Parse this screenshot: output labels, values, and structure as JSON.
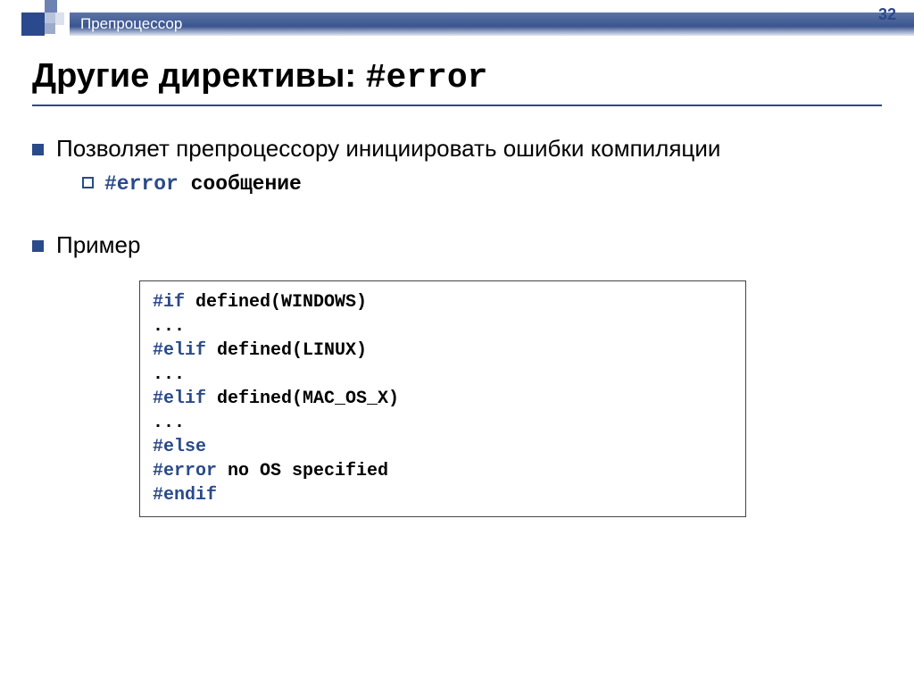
{
  "header": {
    "section_label": "Препроцессор",
    "page_number": "32"
  },
  "title": {
    "prefix": "Другие директивы: ",
    "code": "#error"
  },
  "bullets": {
    "b1": "Позволяет препроцессору инициировать ошибки компиляции",
    "b1_sub_code": "#error",
    "b1_sub_rest": " сообщение",
    "b2": "Пример"
  },
  "code": {
    "l1_kw": "#if",
    "l1_rest": " defined(WINDOWS)",
    "l2": "...",
    "l3_kw": "#elif",
    "l3_rest": " defined(LINUX)",
    "l4": "...",
    "l5_kw": "#elif",
    "l5_rest": " defined(MAC_OS_X)",
    "l6": "...",
    "l7_kw": "#else",
    "l8_kw": "#error",
    "l8_rest": " no OS specified",
    "l9_kw": "#endif"
  }
}
